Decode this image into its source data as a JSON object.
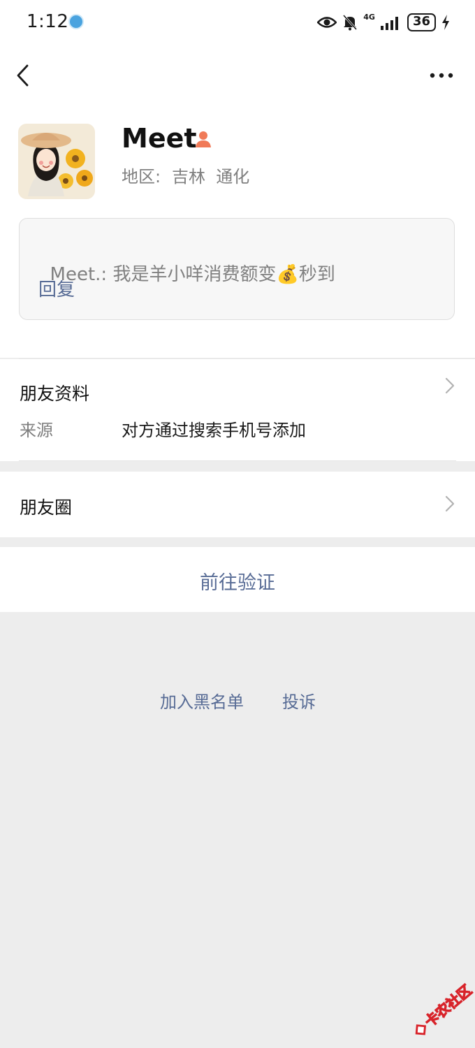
{
  "status_bar": {
    "time": "1:12",
    "network": "4G",
    "battery": "36"
  },
  "profile": {
    "nickname": "Meet.",
    "region_label": "地区:",
    "region_value": "吉林  通化",
    "message": {
      "sender": "Meet.:",
      "text": "我是羊小咩消费额变💰秒到",
      "reply_label": "回复"
    }
  },
  "friend_info": {
    "title": "朋友资料",
    "source_label": "来源",
    "source_value": "对方通过搜索手机号添加"
  },
  "moments": {
    "title": "朋友圈"
  },
  "verify": {
    "label": "前往验证"
  },
  "footer_links": {
    "blacklist": "加入黑名单",
    "report": "投诉"
  },
  "watermark": {
    "text": "卡农社区"
  },
  "colors": {
    "link": "#576b95",
    "background": "#ededed",
    "card": "#ffffff",
    "gender_icon": "#f07a58"
  },
  "icons": {
    "back": "chevron-left-icon",
    "more": "more-dots-icon",
    "gender": "person-icon",
    "row_arrow": "chevron-right-icon"
  }
}
